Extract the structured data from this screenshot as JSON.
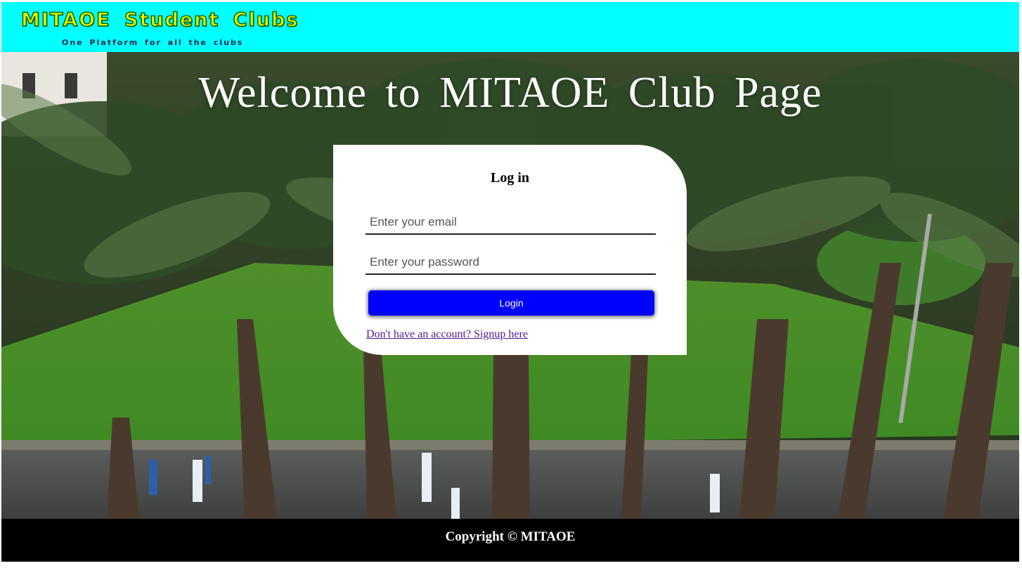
{
  "header": {
    "brand_title": "MITAOE Student Clubs",
    "tagline": "One Platform for all the clubs",
    "background_color": "#00ffff",
    "brand_color": "#d8ff00"
  },
  "hero": {
    "welcome_text": "Welcome to MITAOE Club Page"
  },
  "login": {
    "title": "Log in",
    "email_placeholder": "Enter your email",
    "password_placeholder": "Enter your password",
    "button_label": "Login",
    "button_color": "#0000ff",
    "signup_link": "Don't have an account? Signup here"
  },
  "footer": {
    "copyright": "Copyright © MITAOE"
  }
}
